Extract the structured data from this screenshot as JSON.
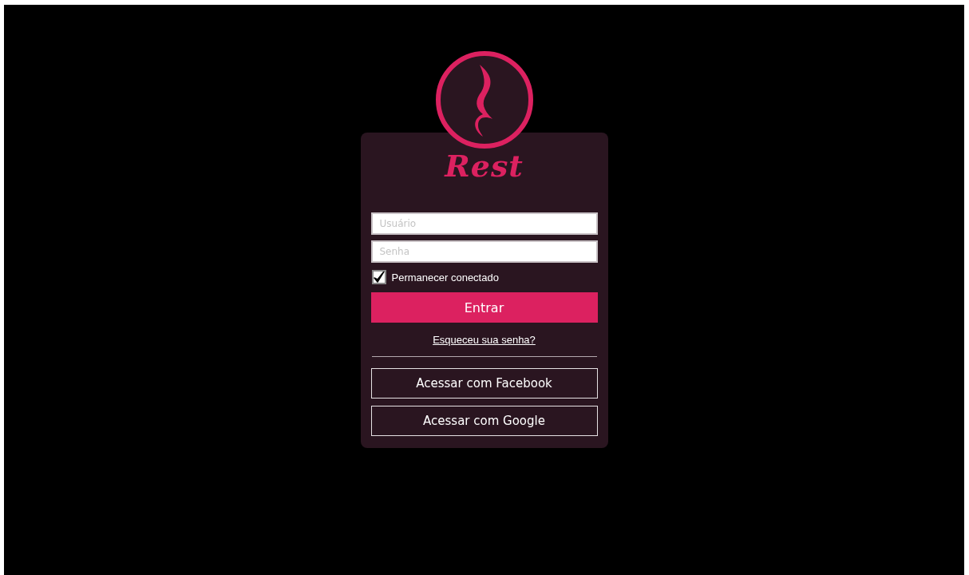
{
  "logo": {
    "text": "Rest"
  },
  "form": {
    "username": {
      "placeholder": "Usuário"
    },
    "password": {
      "placeholder": "Senha"
    },
    "remember": {
      "label": "Permanecer conectado",
      "checked": true
    },
    "submit": "Entrar",
    "forgot_link": "Esqueceu sua senha?",
    "social_buttons": [
      "Acessar com Facebook",
      "Acessar com Google"
    ]
  }
}
